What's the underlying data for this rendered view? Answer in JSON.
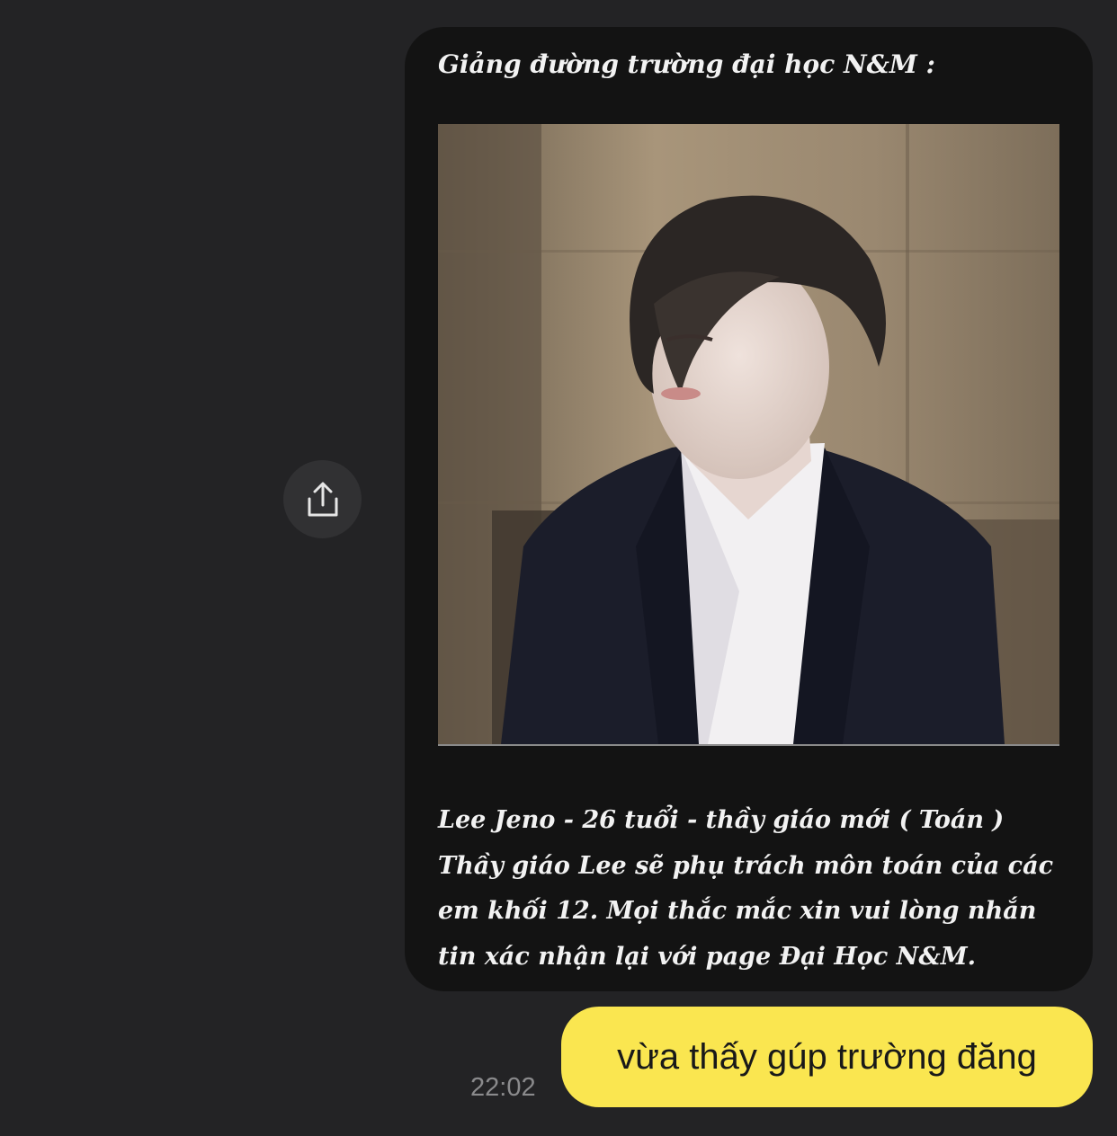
{
  "share_button": {
    "icon": "share-icon"
  },
  "shared_post": {
    "heading": "Giảng đường trường đại học N&M :",
    "body_lines": [
      "Lee Jeno - 26 tuổi - thầy giáo mới ( Toán )",
      "Thầy giáo Lee sẽ phụ trách môn toán của các",
      "em khối 12. Mọi thắc mắc xin vui lòng nhắn",
      "tin xác nhận lại với page Đại Học N&M."
    ]
  },
  "message": {
    "text": "vừa thấy gúp trường đăng",
    "time": "22:02"
  },
  "colors": {
    "background": "#232325",
    "card": "#131313",
    "my_bubble": "#fae650"
  }
}
